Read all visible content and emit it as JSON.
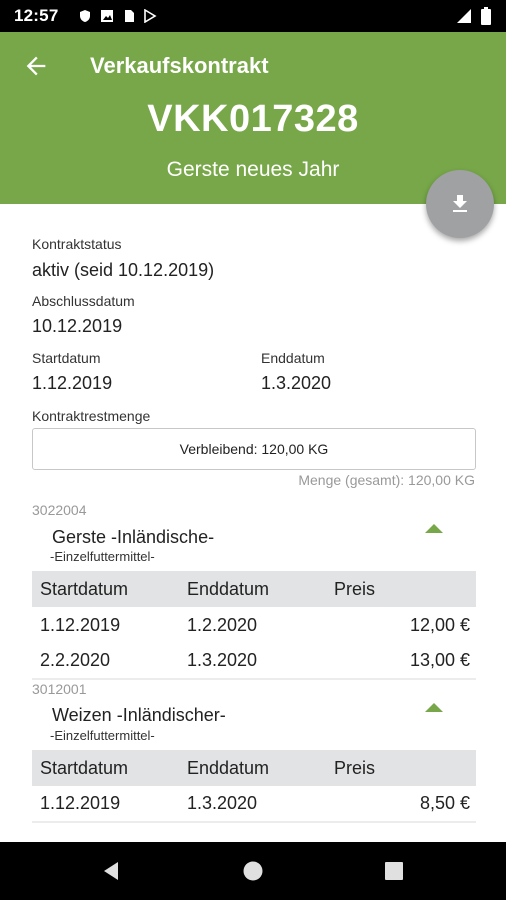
{
  "status_bar": {
    "time": "12:57"
  },
  "header": {
    "title": "Verkaufskontrakt",
    "contract_number": "VKK017328",
    "subtitle": "Gerste neues Jahr"
  },
  "details": {
    "status_label": "Kontraktstatus",
    "status_value": "aktiv (seid 10.12.2019)",
    "closing_label": "Abschlussdatum",
    "closing_value": "10.12.2019",
    "start_label": "Startdatum",
    "start_value": "1.12.2019",
    "end_label": "Enddatum",
    "end_value": "1.3.2020",
    "rest_label": "Kontraktrestmenge",
    "rest_value": "Verbleibend: 120,00 KG",
    "total_value": "Menge (gesamt): 120,00 KG"
  },
  "products": [
    {
      "code": "3022004",
      "name": "Gerste -Inländische-",
      "sub": "-Einzelfuttermittel-",
      "columns": [
        "Startdatum",
        "Enddatum",
        "Preis"
      ],
      "rows": [
        {
          "start": "1.12.2019",
          "end": "1.2.2020",
          "price": "12,00 €"
        },
        {
          "start": "2.2.2020",
          "end": "1.3.2020",
          "price": "13,00 €"
        }
      ]
    },
    {
      "code": "3012001",
      "name": "Weizen -Inländischer-",
      "sub": "-Einzelfuttermittel-",
      "columns": [
        "Startdatum",
        "Enddatum",
        "Preis"
      ],
      "rows": [
        {
          "start": "1.12.2019",
          "end": "1.3.2020",
          "price": "8,50 €"
        }
      ]
    }
  ],
  "colors": {
    "brand": "#77a748",
    "fab": "#9fa1a3",
    "table_header": "#e2e3e4"
  },
  "icons": [
    "arrow-back-icon",
    "download-icon",
    "caret-up-icon",
    "nav-back-icon",
    "nav-home-icon",
    "nav-recents-icon"
  ]
}
